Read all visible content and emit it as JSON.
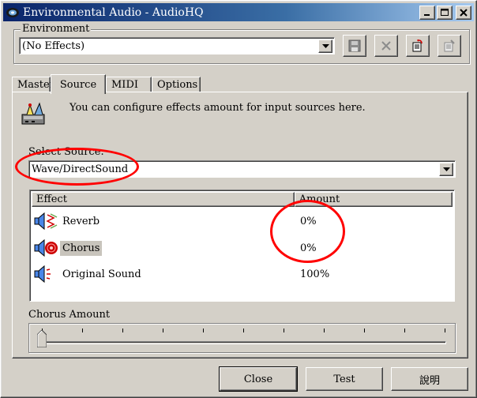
{
  "window": {
    "title": "Environmental Audio - AudioHQ",
    "minimize": "_",
    "maximize": "□",
    "close": "✕"
  },
  "environment": {
    "legend": "Environment",
    "selected": "(No Effects)",
    "tools": [
      "save-icon",
      "delete-icon",
      "edit-icon",
      "properties-icon"
    ]
  },
  "tabs": [
    {
      "label": "Master",
      "active": false
    },
    {
      "label": "Source",
      "active": true
    },
    {
      "label": "MIDI",
      "active": false
    },
    {
      "label": "Options",
      "active": false
    }
  ],
  "source_tab": {
    "hint": "You can configure effects amount for input sources here.",
    "select_label": "Select Source:",
    "selected_source": "Wave/DirectSound",
    "list": {
      "columns": [
        "Effect",
        "Amount"
      ],
      "rows": [
        {
          "effect": "Reverb",
          "amount": "0%",
          "icon": "reverb-speaker-icon"
        },
        {
          "effect": "Chorus",
          "amount": "0%",
          "icon": "chorus-speaker-icon",
          "selected": true
        },
        {
          "effect": "Original Sound",
          "amount": "100%",
          "icon": "original-sound-speaker-icon"
        }
      ]
    },
    "slider": {
      "label": "Chorus Amount",
      "value": 0
    }
  },
  "buttons": {
    "close": "Close",
    "test": "Test",
    "help": "說明"
  },
  "colors": {
    "face": "#d4d0c8",
    "title_start": "#0a246a",
    "title_end": "#a6caf0",
    "annotation": "#ff0000"
  }
}
